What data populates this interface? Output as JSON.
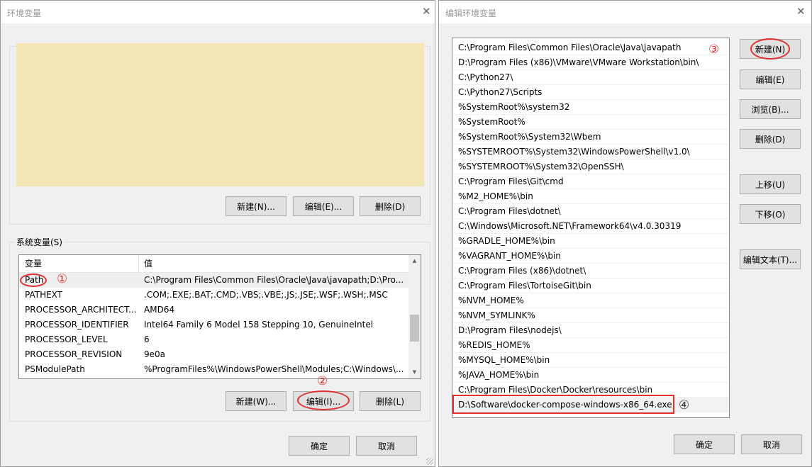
{
  "left_dialog": {
    "title": "环境变量",
    "close_glyph": "✕",
    "user_vars_area_color": "#f2e6b5",
    "user_buttons": {
      "new": "新建(N)...",
      "edit": "编辑(E)...",
      "delete": "删除(D)"
    },
    "system_group_label": "系统变量(S)",
    "system_columns": [
      "变量",
      "值"
    ],
    "system_rows": [
      {
        "name": "Path",
        "value": "C:\\Program Files\\Common Files\\Oracle\\Java\\javapath;D:\\Pro..."
      },
      {
        "name": "PATHEXT",
        "value": ".COM;.EXE;.BAT;.CMD;.VBS;.VBE;.JS;.JSE;.WSF;.WSH;.MSC"
      },
      {
        "name": "PROCESSOR_ARCHITECT...",
        "value": "AMD64"
      },
      {
        "name": "PROCESSOR_IDENTIFIER",
        "value": "Intel64 Family 6 Model 158 Stepping 10, GenuineIntel"
      },
      {
        "name": "PROCESSOR_LEVEL",
        "value": "6"
      },
      {
        "name": "PROCESSOR_REVISION",
        "value": "9e0a"
      },
      {
        "name": "PSModulePath",
        "value": "%ProgramFiles%\\WindowsPowerShell\\Modules;C:\\Windows\\..."
      }
    ],
    "selected_row": 0,
    "system_buttons": {
      "new": "新建(W)...",
      "edit": "编辑(I)...",
      "delete": "删除(L)"
    },
    "ok": "确定",
    "cancel": "取消"
  },
  "right_dialog": {
    "title": "编辑环境变量",
    "close_glyph": "✕",
    "path_entries": [
      "C:\\Program Files\\Common Files\\Oracle\\Java\\javapath",
      "D:\\Program Files (x86)\\VMware\\VMware Workstation\\bin\\",
      "C:\\Python27\\",
      "C:\\Python27\\Scripts",
      "%SystemRoot%\\system32",
      "%SystemRoot%",
      "%SystemRoot%\\System32\\Wbem",
      "%SYSTEMROOT%\\System32\\WindowsPowerShell\\v1.0\\",
      "%SYSTEMROOT%\\System32\\OpenSSH\\",
      "C:\\Program Files\\Git\\cmd",
      "%M2_HOME%\\bin",
      "C:\\Program Files\\dotnet\\",
      "C:\\Windows\\Microsoft.NET\\Framework64\\v4.0.30319",
      "%GRADLE_HOME%\\bin",
      "%VAGRANT_HOME%\\bin",
      "C:\\Program Files (x86)\\dotnet\\",
      "C:\\Program Files\\TortoiseGit\\bin",
      "%NVM_HOME%",
      "%NVM_SYMLINK%",
      "D:\\Program Files\\nodejs\\",
      "%REDIS_HOME%",
      "%MYSQL_HOME%\\bin",
      "%JAVA_HOME%\\bin",
      "C:\\Program Files\\Docker\\Docker\\resources\\bin",
      "D:\\Software\\docker-compose-windows-x86_64.exe"
    ],
    "selected_entry": 24,
    "buttons": {
      "new": "新建(N)",
      "edit": "编辑(E)",
      "browse": "浏览(B)...",
      "delete": "删除(D)",
      "move_up": "上移(U)",
      "move_down": "下移(O)",
      "edit_text": "编辑文本(T)..."
    },
    "ok": "确定",
    "cancel": "取消"
  },
  "annotations": {
    "step1": "①",
    "step2": "②",
    "step3": "③",
    "step4": "④",
    "accent": "#e03030"
  }
}
